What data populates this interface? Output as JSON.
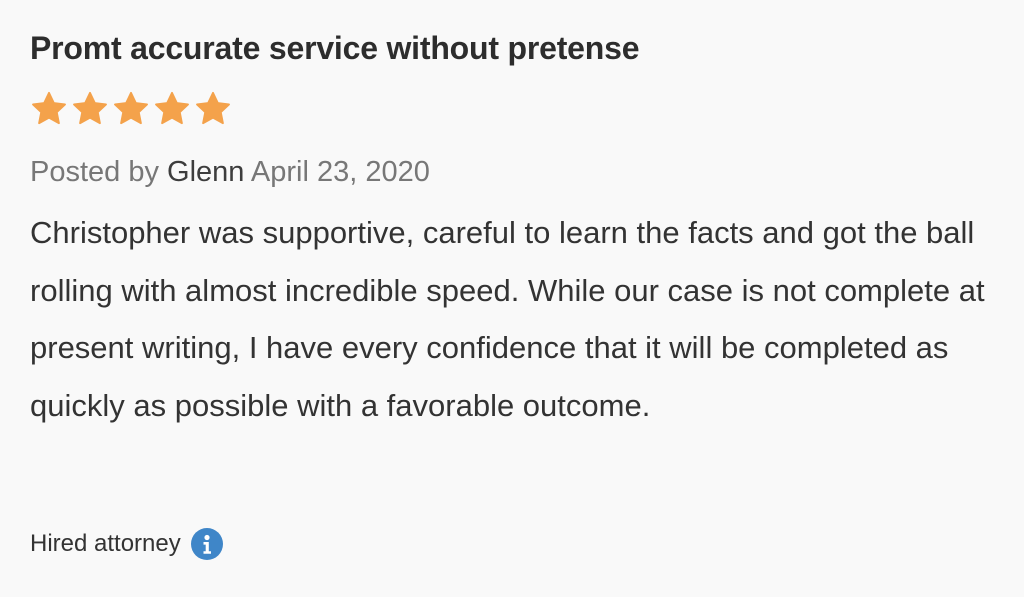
{
  "review": {
    "title": "Promt accurate service without pretense",
    "rating": 5,
    "rating_max": 5,
    "star_color": "#f4a24b",
    "meta": {
      "posted_by_label": "Posted by",
      "author": "Glenn",
      "date": "April 23, 2020"
    },
    "body": "Christopher was supportive, careful to learn the facts and got the ball rolling with almost incredible speed. While our case is not complete at present writing, I have every confidence that it will be completed as quickly as possible with a favorable outcome.",
    "footer": {
      "hired_label": "Hired attorney",
      "info_icon": "info-icon",
      "info_color": "#3f86c8"
    }
  }
}
